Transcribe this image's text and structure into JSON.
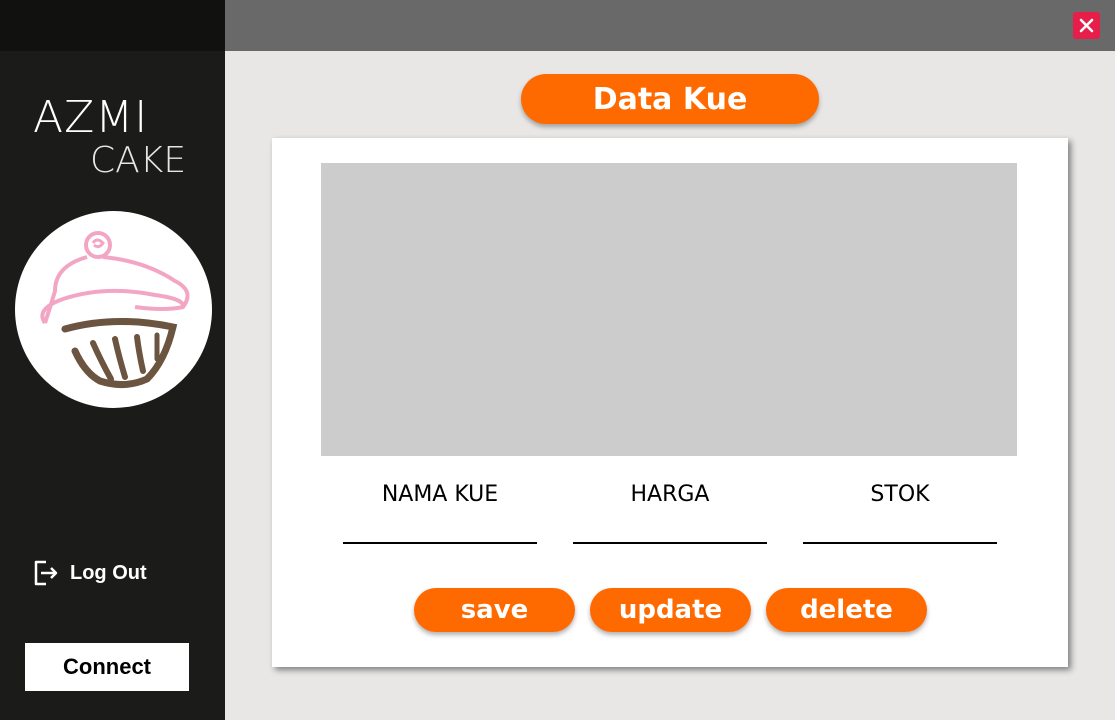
{
  "brand": {
    "line1": "AZMI",
    "line2": "CAKE"
  },
  "sidebar": {
    "logout_label": "Log Out",
    "connect_label": "Connect"
  },
  "main": {
    "title": "Data Kue",
    "fields": [
      {
        "label": "NAMA KUE",
        "value": ""
      },
      {
        "label": "HARGA",
        "value": ""
      },
      {
        "label": "STOK",
        "value": ""
      }
    ],
    "actions": {
      "save": "save",
      "update": "update",
      "delete": "delete"
    }
  },
  "colors": {
    "accent": "#ff6a00",
    "sidebar_bg": "#1b1b19",
    "titlebar_bg": "#696969",
    "close": "#e81e4a",
    "content_bg": "#e8e7e6",
    "grid_bg": "#cccccc",
    "logo_pink": "#f2a6c4",
    "logo_brown": "#6b5440"
  },
  "icons": {
    "close": "close-icon",
    "logout": "logout-icon",
    "logo": "cupcake-icon"
  }
}
